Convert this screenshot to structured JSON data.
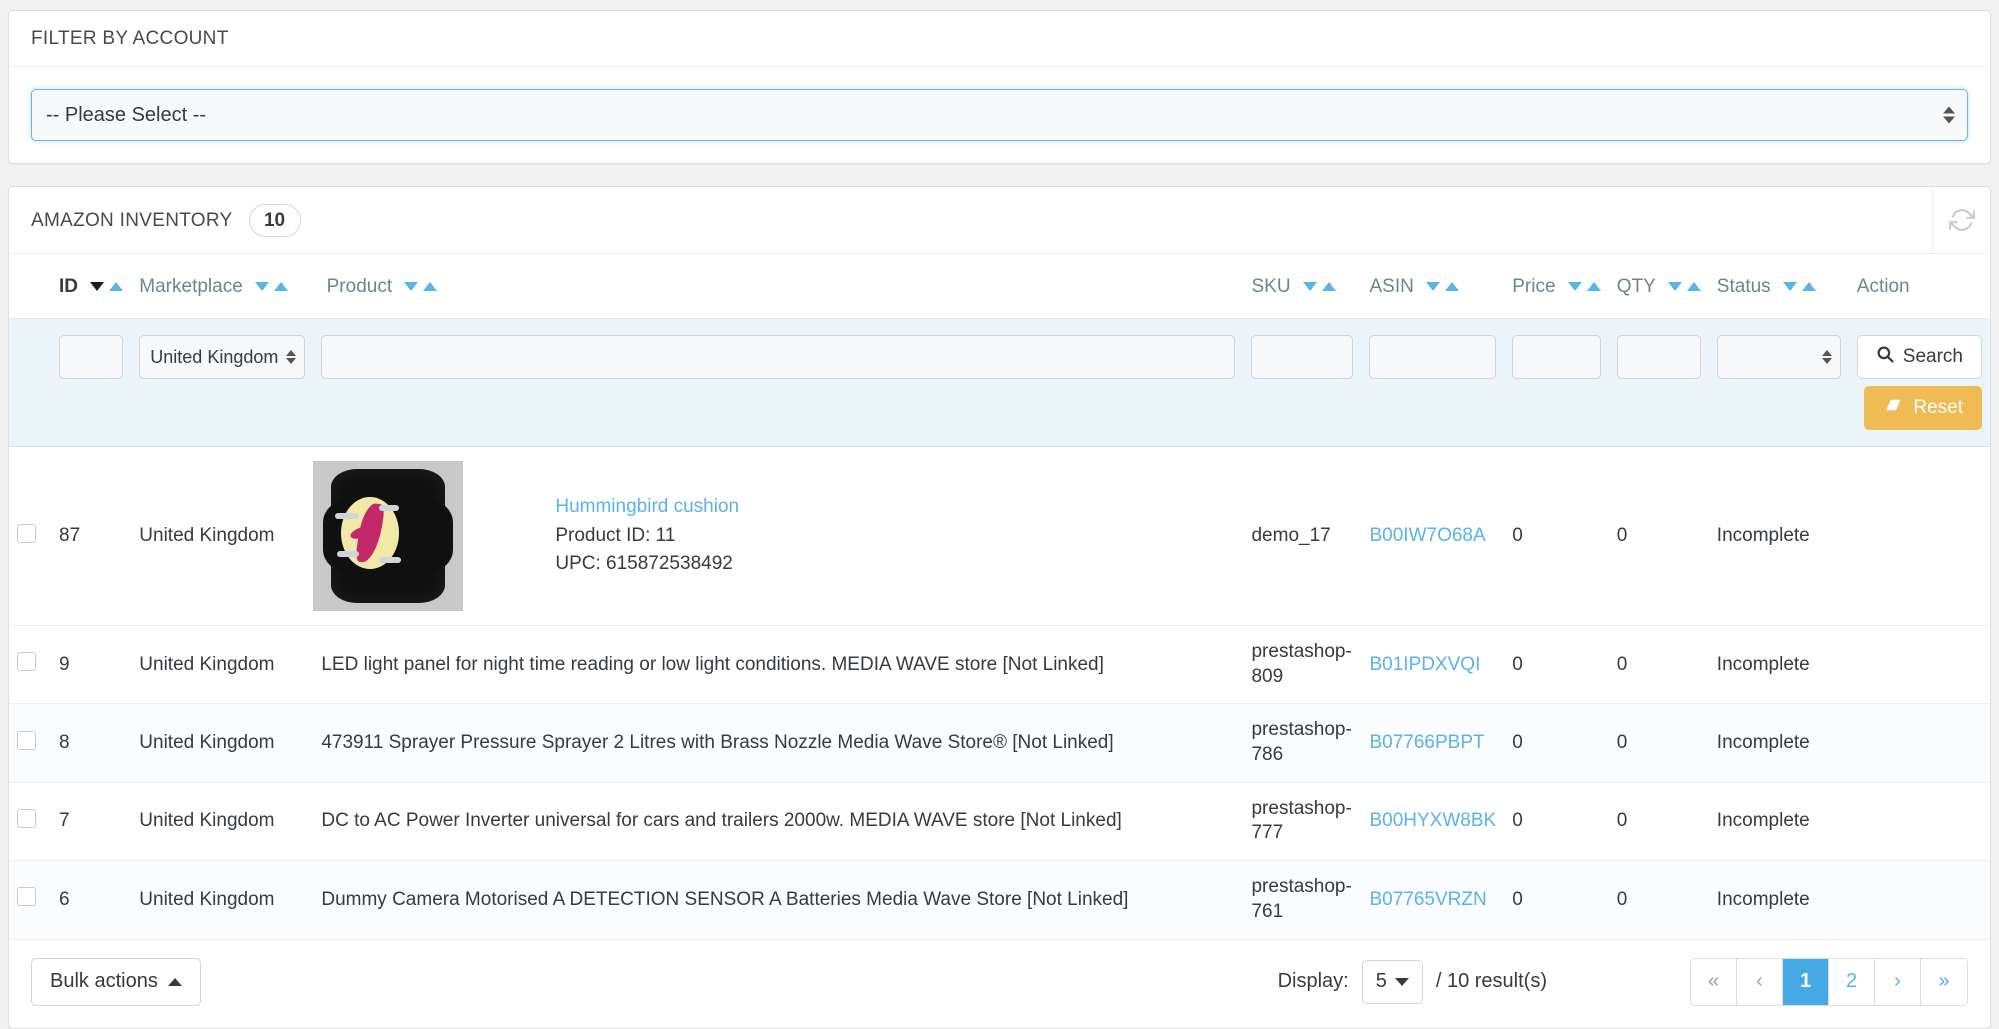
{
  "filter_panel": {
    "title": "FILTER BY ACCOUNT",
    "account_select": {
      "value": "-- Please Select --",
      "icon": "spinner-arrows-icon"
    }
  },
  "inventory_panel": {
    "title": "AMAZON INVENTORY",
    "count": "10",
    "refresh_icon": "refresh-icon",
    "columns": [
      {
        "label": "ID",
        "sortable": true,
        "active_sort": "desc"
      },
      {
        "label": "Marketplace",
        "sortable": true
      },
      {
        "label": "Product",
        "sortable": true
      },
      {
        "label": "SKU",
        "sortable": true
      },
      {
        "label": "ASIN",
        "sortable": true
      },
      {
        "label": "Price",
        "sortable": true
      },
      {
        "label": "QTY",
        "sortable": true
      },
      {
        "label": "Status",
        "sortable": true
      },
      {
        "label": "Action",
        "sortable": false
      }
    ],
    "filters": {
      "id": {
        "value": "",
        "placeholder": ""
      },
      "marketplace": {
        "value": "United Kingdom"
      },
      "product": {
        "value": "",
        "placeholder": ""
      },
      "sku": {
        "value": "",
        "placeholder": ""
      },
      "asin": {
        "value": "",
        "placeholder": ""
      },
      "price": {
        "value": "",
        "placeholder": ""
      },
      "qty": {
        "value": "",
        "placeholder": ""
      },
      "status": {
        "value": ""
      },
      "search_label": "Search",
      "search_icon": "search-icon",
      "reset_label": "Reset",
      "reset_icon": "eraser-icon"
    },
    "rows": [
      {
        "id": "87",
        "marketplace": "United Kingdom",
        "has_thumb": true,
        "thumb_alt": "hummingbird-cushion-thumbnail",
        "product_title": "Hummingbird cushion",
        "product_id_line": "Product ID: 11",
        "upc_line": "UPC: 615872538492",
        "product_plain": "",
        "sku": "demo_17",
        "asin": "B00IW7O68A",
        "price": "0",
        "qty": "0",
        "status": "Incomplete"
      },
      {
        "id": "9",
        "marketplace": "United Kingdom",
        "has_thumb": false,
        "product_plain": "LED light panel for night time reading or low light conditions. MEDIA WAVE store [Not Linked]",
        "sku": "prestashop-809",
        "asin": "B01IPDXVQI",
        "price": "0",
        "qty": "0",
        "status": "Incomplete"
      },
      {
        "id": "8",
        "marketplace": "United Kingdom",
        "has_thumb": false,
        "product_plain": "473911 Sprayer Pressure Sprayer 2 Litres with Brass Nozzle Media Wave Store® [Not Linked]",
        "sku": "prestashop-786",
        "asin": "B07766PBPT",
        "price": "0",
        "qty": "0",
        "status": "Incomplete"
      },
      {
        "id": "7",
        "marketplace": "United Kingdom",
        "has_thumb": false,
        "product_plain": "DC to AC Power Inverter universal for cars and trailers 2000w. MEDIA WAVE store [Not Linked]",
        "sku": "prestashop-777",
        "asin": "B00HYXW8BK",
        "price": "0",
        "qty": "0",
        "status": "Incomplete"
      },
      {
        "id": "6",
        "marketplace": "United Kingdom",
        "has_thumb": false,
        "product_plain": "Dummy Camera Motorised A DETECTION SENSOR A Batteries Media Wave Store [Not Linked]",
        "sku": "prestashop-761",
        "asin": "B07765VRZN",
        "price": "0",
        "qty": "0",
        "status": "Incomplete"
      }
    ],
    "footer": {
      "bulk_actions_label": "Bulk actions",
      "bulk_actions_caret": "caret-up-icon",
      "display_label": "Display:",
      "display_value": "5",
      "results_label": "/ 10 result(s)",
      "pagination": [
        {
          "label": "«",
          "name": "first",
          "active": false,
          "muted": true
        },
        {
          "label": "‹",
          "name": "previous",
          "active": false,
          "muted": true
        },
        {
          "label": "1",
          "name": "page-1",
          "active": true,
          "muted": false
        },
        {
          "label": "2",
          "name": "page-2",
          "active": false,
          "muted": false
        },
        {
          "label": "›",
          "name": "next",
          "active": false,
          "muted": false
        },
        {
          "label": "»",
          "name": "last",
          "active": false,
          "muted": false
        }
      ]
    }
  },
  "colors": {
    "accent_blue": "#5bb3e8",
    "active_page_blue": "#45a9e5",
    "reset_amber": "#eebb55",
    "filter_row_bg": "#eaf4f9"
  }
}
